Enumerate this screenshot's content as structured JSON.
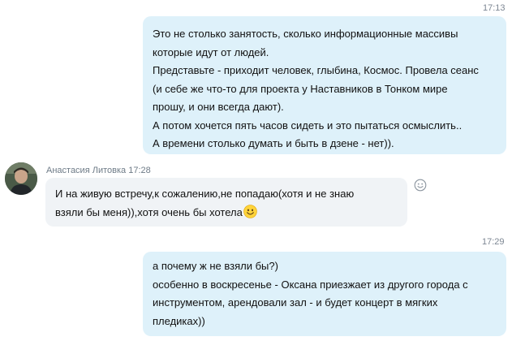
{
  "messages": {
    "m1": {
      "time": "17:13",
      "lines": [
        "Это не столько занятость, сколько информационные массивы",
        "которые идут от людей.",
        "Представьте - приходит человек, глыбина, Космос. Провела сеанс",
        "(и себе же что-то для проекта у Наставников в Тонком мире",
        "прошу, и они всегда дают).",
        "А потом хочется пять часов сидеть и это пытаться осмыслить..",
        "А времени столько думать и быть в дзене - нет))."
      ]
    },
    "m2": {
      "sender": "Анастасия Литовка",
      "time": "17:28",
      "lines": [
        "И на живую встречу,к сожалению,не попадаю(хотя и не знаю",
        "взяли бы меня)),хотя очень бы хотела"
      ],
      "emoji": "smile-emoji"
    },
    "m3": {
      "time": "17:29",
      "lines": [
        "а почему ж не взяли бы?)",
        "особенно в воскресенье - Оксана приезжает из другого города с",
        "инструментом, арендовали зал - и будет концерт в мягких",
        "пледиках))"
      ]
    }
  },
  "icons": {
    "react": "emoji-react-icon",
    "avatar": "avatar"
  },
  "colors": {
    "outgoing_bubble": "#def1fa",
    "incoming_bubble": "#f0f3f6",
    "timestamp": "#7d8793"
  }
}
